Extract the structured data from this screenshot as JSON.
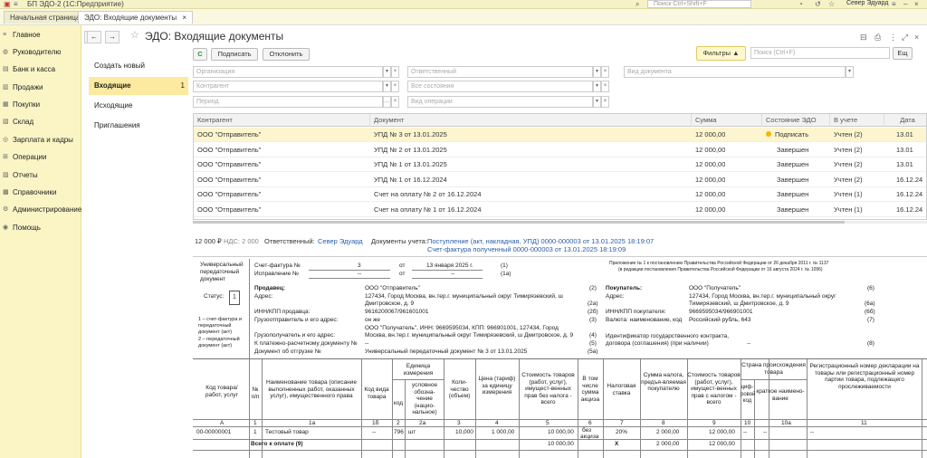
{
  "window": {
    "app_title": "БП ЭДО-2  (1С:Предприятие)",
    "search_placeholder": "Поиск Ctrl+Shift+F",
    "user": "Север Эдуард"
  },
  "tabs": [
    {
      "label": "Начальная страница"
    },
    {
      "label": "ЭДО: Входящие документы",
      "close": "×"
    }
  ],
  "sidebar": {
    "items": [
      {
        "label": "Главное"
      },
      {
        "label": "Руководителю"
      },
      {
        "label": "Банк и касса"
      },
      {
        "label": "Продажи"
      },
      {
        "label": "Покупки"
      },
      {
        "label": "Склад"
      },
      {
        "label": "Зарплата и кадры"
      },
      {
        "label": "Операции"
      },
      {
        "label": "Отчеты"
      },
      {
        "label": "Справочники"
      },
      {
        "label": "Администрирование"
      },
      {
        "label": "Помощь"
      }
    ]
  },
  "subnav": {
    "items": [
      {
        "label": "Создать новый"
      },
      {
        "label": "Входящие",
        "count": "1"
      },
      {
        "label": "Исходящие"
      },
      {
        "label": "Приглашения"
      }
    ]
  },
  "header": {
    "title": "ЭДО: Входящие документы",
    "back": "←",
    "forward": "→"
  },
  "toolbar": {
    "refresh": "C",
    "sign": "Подписать",
    "reject": "Отклонить",
    "filters": "Фильтры ▲",
    "search_placeholder": "Поиск (Ctrl+F)",
    "more": "Ещ"
  },
  "filters": {
    "organization": "Организация",
    "responsible": "Ответственный",
    "doc_type": "Вид документа",
    "counterparty": "Контрагент",
    "status": "Все состояния",
    "period": "Период",
    "doc_kind": "Вид операции"
  },
  "grid": {
    "columns": [
      "Контрагент",
      "Документ",
      "Сумма",
      "Состояние ЭДО",
      "В учете",
      "Дата"
    ],
    "rows": [
      {
        "counterparty": "ООО \"Отправитель\"",
        "document": "УПД № 3 от 13.01.2025",
        "sum": "12 000,00",
        "status": "Подписать",
        "accounting": "Учтен (2)",
        "date": "13.01",
        "selected": true
      },
      {
        "counterparty": "ООО \"Отправитель\"",
        "document": "УПД № 2 от 13.01.2025",
        "sum": "12 000,00",
        "status": "Завершен",
        "accounting": "Учтен (2)",
        "date": "13.01"
      },
      {
        "counterparty": "ООО \"Отправитель\"",
        "document": "УПД № 1 от 13.01.2025",
        "sum": "12 000,00",
        "status": "Завершен",
        "accounting": "Учтен (2)",
        "date": "13.01"
      },
      {
        "counterparty": "ООО \"Отправитель\"",
        "document": "УПД № 1 от 16.12.2024",
        "sum": "12 000,00",
        "status": "Завершен",
        "accounting": "Учтен (2)",
        "date": "16.12.24"
      },
      {
        "counterparty": "ООО \"Отправитель\"",
        "document": "Счет на оплату № 2 от 16.12.2024",
        "sum": "12 000,00",
        "status": "Завершен",
        "accounting": "Учтен (1)",
        "date": "16.12.24"
      },
      {
        "counterparty": "ООО \"Отправитель\"",
        "document": "Счет на оплату № 1 от 16.12.2024",
        "sum": "12 000,00",
        "status": "Завершен",
        "accounting": "Учтен (1)",
        "date": "16.12.24"
      }
    ]
  },
  "info": {
    "total": "12 000 ₽",
    "vat": "НДС: 2 000",
    "responsible_label": "Ответственный:",
    "responsible": "Север Эдуард",
    "docs_label": "Документы учета:",
    "doc1": "Поступление (акт, накладная, УПД) 0000-000003 от 13.01.2025 18:19:07",
    "doc2": "Счет-фактура полученный 0000-000003 от 13.01.2025 18:19:09"
  },
  "upd": {
    "left_title_1": "Универсальный",
    "left_title_2": "передаточный",
    "left_title_3": "документ",
    "status_label": "Статус:",
    "status_value": "1",
    "note1": "1 – счет-фактура и",
    "note2": "передаточный",
    "note3": "документ (акт)",
    "note4": "2 – передаточный",
    "note5": "документ (акт)",
    "invoice_label": "Счет-фактура №",
    "invoice_no": "3",
    "from": "от",
    "invoice_date": "13 января 2025 г.",
    "l1": "(1)",
    "correction_label": "Исправление №",
    "dash": "--",
    "l1a": "(1а)",
    "appendix1": "Приложение № 1 к постановлению Правительства Российской Федерации от 26 декабря 2011 г. № 1137",
    "appendix2": "(в редакции постановления Правительства Российской Федерации от 16 августа 2024 г. № 1096)",
    "seller_label": "Продавец:",
    "seller": "ООО \"Отправитель\"",
    "n2": "(2)",
    "address_label": "Адрес:",
    "seller_addr1": "127434, Город Москва, вн.тер.г. муниципальный округ Тимирязевский, ш",
    "seller_addr2": "Дмитровское, д. 9",
    "n2a": "(2а)",
    "inn_seller_label": "ИНН/КПП продавца:",
    "inn_seller": "9616200067/961601001",
    "n2b": "(2б)",
    "shipper_label": "Грузоотправитель и его адрес:",
    "shipper": "он же",
    "n3": "(3)",
    "consignee_label": "Грузополучатель и его адрес:",
    "consignee1": "ООО \"Получатель\", ИНН: 9669595034, КПП: 966901001, 127434, Город",
    "consignee2": "Москва, вн.тер.г. муниципальный округ Тимирязевский, ш Дмитровское, д. 9",
    "n4": "(4)",
    "payment_label": "К платежно-расчетному документу №",
    "n5": "(5)",
    "shipdoc_label": "Документ об отгрузке №",
    "shipdoc": "Универсальный передаточный документ № 3 от 13.01.2025",
    "n5a": "(5а)",
    "buyer_label": "Покупатель:",
    "buyer": "ООО \"Получатель\"",
    "n6": "(6)",
    "buyer_addr1": "127434, Город Москва, вн.тер.г. муниципальный округ",
    "buyer_addr2": "Тимирязевский, ш Дмитровское, д. 9",
    "n6a": "(6а)",
    "inn_buyer_label": "ИНН/КПП покупателя:",
    "inn_buyer": "9669595034/966901001",
    "n6b": "(6б)",
    "currency_label": "Валюта: наименование, код",
    "currency": "Российский рубль, 643",
    "n7": "(7)",
    "gov_label1": "Идентификатор государственного контракта,",
    "gov_label2": "договора (соглашения) (при наличии)",
    "n8": "(8)"
  },
  "table": {
    "headers": {
      "code": "Код товара/ работ, услуг",
      "num": "№ п/п",
      "name": "Наименование товара (описание выполненных работ, оказанных услуг), имущественного права",
      "kind": "Код вида товара",
      "unit": "Единица измерения",
      "unit_code": "код",
      "unit_name": "условное обозна-чение (нацио-нальное)",
      "qty": "Коли-чество (объем)",
      "price": "Цена (тариф) за единицу измерения",
      "cost": "Стоимость товаров (работ, услуг), имущест-венных прав без налога - всего",
      "excise": "В том числе сумма акциза",
      "rate": "Налоговая ставка",
      "tax": "Сумма налога, предъя-вляемая покупателю",
      "total": "Стоимость товаров (работ, услуг), имущест-венных прав с налогом - всего",
      "country": "Страна происхождения товара",
      "country_code": "циф-ровой код",
      "country_name": "краткое наимено-вание",
      "reg": "Регистрационный номер декларации на товары или регистрационный номер партии товара, подлежащего прослеживаемости"
    },
    "numbers": [
      "А",
      "1",
      "1а",
      "1б",
      "2",
      "2а",
      "3",
      "4",
      "5",
      "6",
      "7",
      "8",
      "9",
      "10",
      "10а",
      "11"
    ],
    "row": {
      "code": "00-00000001",
      "num": "1",
      "name": "Тестовый товар",
      "kind": "--",
      "unit_code": "796",
      "unit_name": "шт",
      "qty": "10,000",
      "price": "1 000,00",
      "cost": "10 000,00",
      "excise_1": "без",
      "excise_2": "акциза",
      "rate": "20%",
      "tax": "2 000,00",
      "total": "12 000,00",
      "country_code": "--",
      "country_name": "--",
      "reg": "--"
    },
    "total_row": {
      "label": "Всего к оплате (9)",
      "cost": "10 000,00",
      "rate": "X",
      "tax": "2 000,00",
      "total": "12 000,00"
    }
  }
}
